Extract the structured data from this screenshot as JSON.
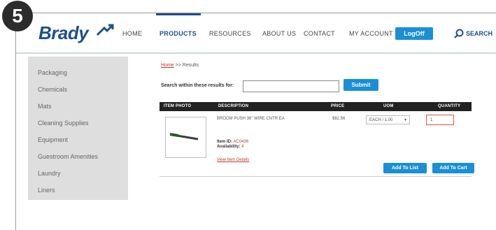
{
  "step_number": "5",
  "brand": {
    "name": "Brady",
    "accent": "#1d4f8e",
    "button_color": "#1a8fd8"
  },
  "nav": {
    "items": [
      "HOME",
      "PRODUCTS",
      "RESOURCES",
      "ABOUT US",
      "CONTACT",
      "MY ACCOUNT"
    ],
    "active": "PRODUCTS",
    "logoff_label": "LogOff",
    "search_label": "SEARCH"
  },
  "sidebar": {
    "items": [
      "Packaging",
      "Chemicals",
      "Mats",
      "Cleaning Supplies",
      "Equipment",
      "Guestroom Amenities",
      "Laundry",
      "Liners"
    ]
  },
  "breadcrumb": {
    "home": "Home",
    "separator": ">>",
    "current": "Results"
  },
  "search_within": {
    "label": "Search within these results for:",
    "value": "",
    "submit_label": "Submit"
  },
  "results_table": {
    "columns": [
      "ITEM PHOTO",
      "DESCRIPTION",
      "PRICE",
      "UOM",
      "QUANTITY"
    ],
    "rows": [
      {
        "description": "BROOM PUSH 36\" WIRE CNTR EA",
        "price": "$82.56",
        "uom": "EACH / 1.00",
        "quantity": "1",
        "item_id_label": "Item ID:",
        "item_id": "AC0436",
        "availability_label": "Availability:",
        "availability": "4",
        "view_details": "View Item Details",
        "add_to_list": "Add To List",
        "add_to_cart": "Add To Cart"
      }
    ]
  }
}
